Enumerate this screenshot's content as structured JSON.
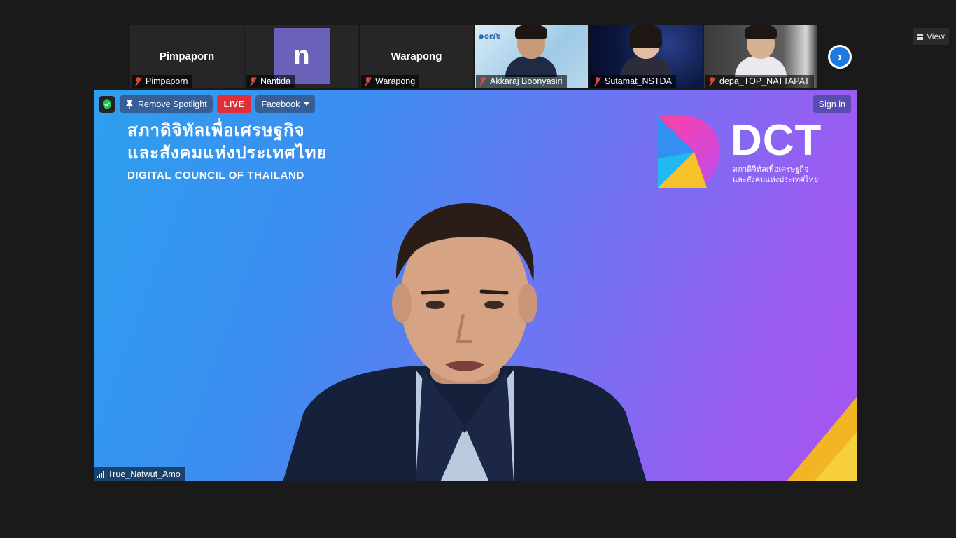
{
  "participants": [
    {
      "display": "Pimpaporn",
      "label": "Pimpaporn",
      "type": "name"
    },
    {
      "display": "n",
      "label": "Nantida",
      "type": "avatar",
      "avatar_color": "#6a62b8"
    },
    {
      "display": "Warapong",
      "label": "Warapong",
      "type": "name"
    },
    {
      "label": "Akkaraj Boonyasiri",
      "type": "video"
    },
    {
      "label": "Sutamat_NSTDA",
      "type": "video"
    },
    {
      "label": "depa_TOP_NATTAPAT",
      "type": "video"
    }
  ],
  "thumb_logo_text": "๑๐๗๖",
  "toolbar": {
    "remove_spotlight": "Remove Spotlight",
    "live": "LIVE",
    "facebook": "Facebook",
    "sign_in": "Sign in",
    "view": "View"
  },
  "main_video": {
    "org_thai_line1": "สภาดิจิทัลเพื่อเศรษฐกิจ",
    "org_thai_line2": "และสังคมแห่งประเทศไทย",
    "org_english": "DIGITAL COUNCIL OF THAILAND",
    "brand": "DCT",
    "brand_sub_line1": "สภาดิจิทัลเพื่อเศรษฐกิจ",
    "brand_sub_line2": "และสังคมแห่งประเทศไทย",
    "speaker_name": "True_Natwut_Amo"
  },
  "colors": {
    "live_red": "#e02f3a",
    "mic_muted": "#e0433a",
    "accent_blue": "#1f78e0"
  }
}
